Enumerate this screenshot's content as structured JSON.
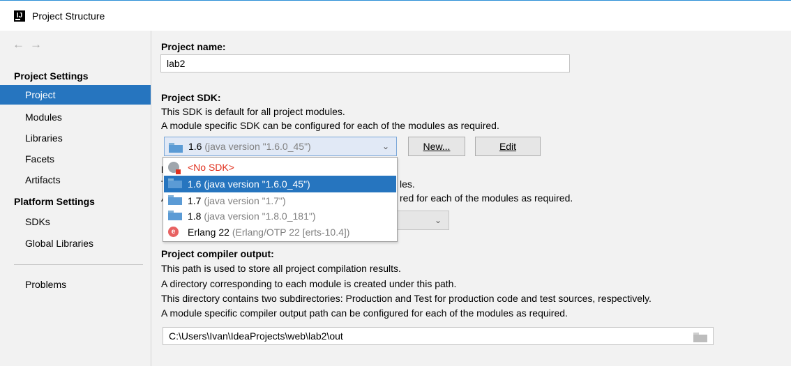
{
  "window": {
    "title": "Project Structure",
    "app_icon": "intellij-idea-icon"
  },
  "sidebar": {
    "nav": {
      "back": "←",
      "forward": "→"
    },
    "project_settings_header": "Project Settings",
    "project_settings_items": [
      "Project",
      "Modules",
      "Libraries",
      "Facets",
      "Artifacts"
    ],
    "platform_settings_header": "Platform Settings",
    "platform_settings_items": [
      "SDKs",
      "Global Libraries"
    ],
    "problems": "Problems",
    "selected": "Project"
  },
  "main": {
    "project_name": {
      "label": "Project name:",
      "value": "lab2"
    },
    "project_sdk": {
      "label": "Project SDK:",
      "desc1": "This SDK is default for all project modules.",
      "desc2": "A module specific SDK can be configured for each of the modules as required.",
      "selected_version": "1.6",
      "selected_detail": "(java version \"1.6.0_45\")",
      "new_button": "New...",
      "edit_button": "Edit"
    },
    "project_language_level": {
      "label_fragment": "F",
      "desc1_start": "T",
      "desc1_end": "les.",
      "desc2_start": "A",
      "desc2_end": "red for each of the modules as required."
    },
    "compiler_output": {
      "label": "Project compiler output:",
      "desc1": "This path is used to store all project compilation results.",
      "desc2": "A directory corresponding to each module is created under this path.",
      "desc3": "This directory contains two subdirectories: Production and Test for production code and test sources, respectively.",
      "desc4": "A module specific compiler output path can be configured for each of the modules as required.",
      "path": "C:\\Users\\Ivan\\IdeaProjects\\web\\lab2\\out"
    }
  },
  "sdk_dropdown": {
    "items": [
      {
        "name": "<No SDK>",
        "detail": "",
        "icon": "no-sdk-icon"
      },
      {
        "name": "1.6",
        "detail": "(java version \"1.6.0_45\")",
        "icon": "java-sdk-icon"
      },
      {
        "name": "1.7",
        "detail": "(java version \"1.7\")",
        "icon": "java-sdk-icon"
      },
      {
        "name": "1.8",
        "detail": "(java version \"1.8.0_181\")",
        "icon": "java-sdk-icon"
      },
      {
        "name": "Erlang 22",
        "detail": "(Erlang/OTP 22 [erts-10.4])",
        "icon": "erlang-icon"
      }
    ],
    "selected_index": 1
  },
  "colors": {
    "selection": "#2675bf",
    "accent_border": "#2b8fd6",
    "error_red": "#e0301e"
  }
}
